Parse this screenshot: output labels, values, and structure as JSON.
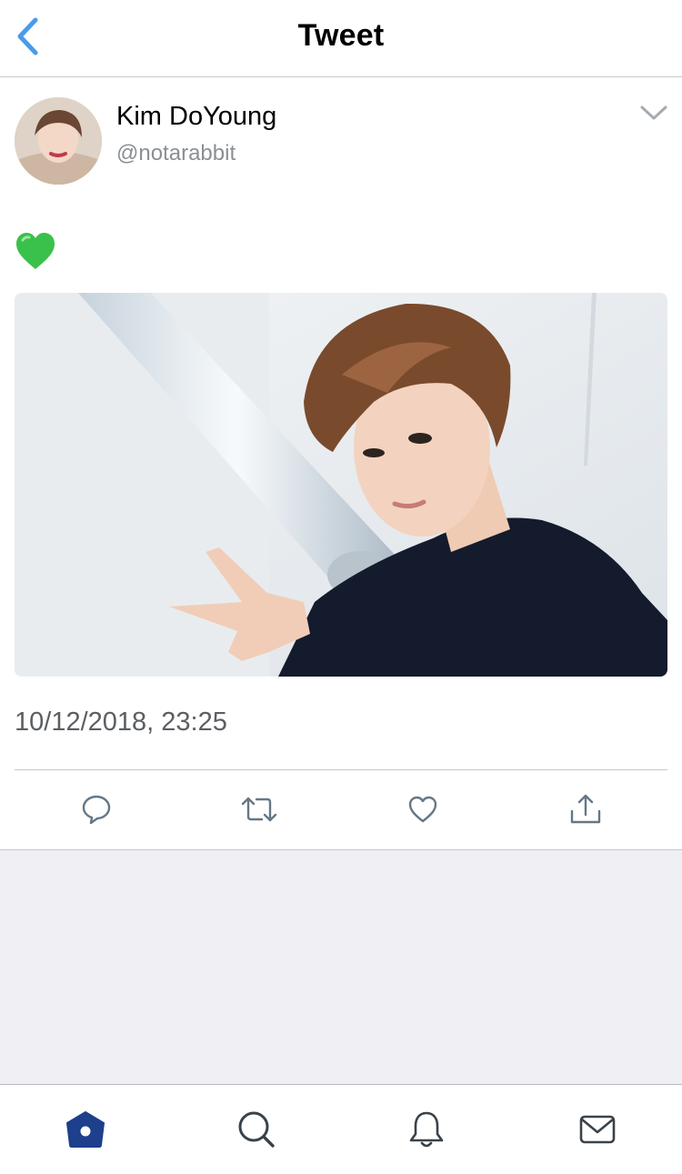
{
  "header": {
    "title": "Tweet",
    "back_icon": "chevron-left-icon"
  },
  "author": {
    "display_name": "Kim DoYoung",
    "handle": "@notarabbit"
  },
  "tweet": {
    "text": "💚",
    "timestamp": "10/12/2018, 23:25"
  },
  "actions": [
    {
      "name": "reply",
      "icon": "reply-bubble-icon"
    },
    {
      "name": "retweet",
      "icon": "retweet-icon"
    },
    {
      "name": "like",
      "icon": "heart-icon"
    },
    {
      "name": "share",
      "icon": "share-icon"
    }
  ],
  "tabbar": {
    "items": [
      {
        "name": "home",
        "icon": "home-icon",
        "selected": true
      },
      {
        "name": "search",
        "icon": "search-icon",
        "selected": false
      },
      {
        "name": "notifications",
        "icon": "bell-icon",
        "selected": false
      },
      {
        "name": "messages",
        "icon": "mail-icon",
        "selected": false
      }
    ]
  },
  "colors": {
    "accent": "#4a9bea",
    "icon_gray": "#657786",
    "tab_active": "#1d3f8c",
    "tab_inactive": "#39424a",
    "background_gray": "#efeff4"
  }
}
